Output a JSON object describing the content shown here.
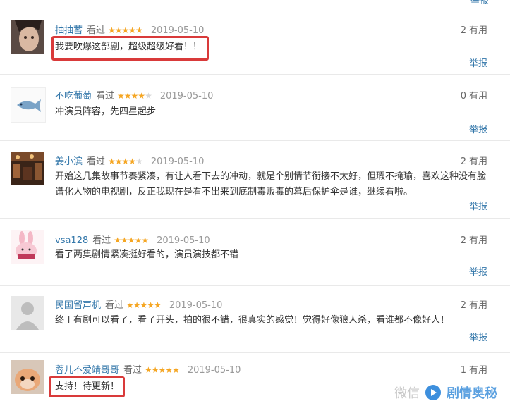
{
  "top_report": "举报",
  "reviews": [
    {
      "author": "抽抽蓄",
      "seen": "看过",
      "stars": 5,
      "date": "2019-05-10",
      "useful_count": "2",
      "useful_label": "有用",
      "content": "我要吹爆这部剧，超级超级好看！！",
      "report": "举报",
      "highlighted": true,
      "avatar": "woman-photo"
    },
    {
      "author": "不吃葡萄",
      "seen": "看过",
      "stars": 4,
      "date": "2019-05-10",
      "useful_count": "0",
      "useful_label": "有用",
      "content": "冲演员阵容，先四星起步",
      "report": "举报",
      "highlighted": false,
      "avatar": "fish-drawing"
    },
    {
      "author": "姜小滨",
      "seen": "看过",
      "stars": 4,
      "date": "2019-05-10",
      "useful_count": "2",
      "useful_label": "有用",
      "content": "开始这几集故事节奏紧凑，有让人看下去的冲动，就是个别情节衔接不太好，但瑕不掩瑜，喜欢这种没有脸谱化人物的电视剧，反正我现在是看不出来到底制毒贩毒的幕后保护伞是谁，继续看啦。",
      "report": "举报",
      "highlighted": false,
      "avatar": "restaurant-photo"
    },
    {
      "author": "vsa128",
      "seen": "看过",
      "stars": 5,
      "date": "2019-05-10",
      "useful_count": "2",
      "useful_label": "有用",
      "content": "看了两集剧情紧凑挺好看的，演员演技都不错",
      "report": "举报",
      "highlighted": false,
      "avatar": "pink-bunny"
    },
    {
      "author": "民国留声机",
      "seen": "看过",
      "stars": 5,
      "date": "2019-05-10",
      "useful_count": "2",
      "useful_label": "有用",
      "content": "终于有剧可以看了，看了开头，拍的很不错，很真实的感觉！觉得好像狼人杀，看谁都不像好人！",
      "report": "举报",
      "highlighted": false,
      "avatar": "default-avatar"
    },
    {
      "author": "蓉儿不爱靖哥哥",
      "seen": "看过",
      "stars": 5,
      "date": "2019-05-10",
      "useful_count": "1",
      "useful_label": "有用",
      "content": "支持！待更新！",
      "report": "",
      "highlighted": true,
      "avatar": "cat-photo"
    }
  ],
  "watermark": {
    "prefix": "微信",
    "brand": "剧情奥秘"
  }
}
